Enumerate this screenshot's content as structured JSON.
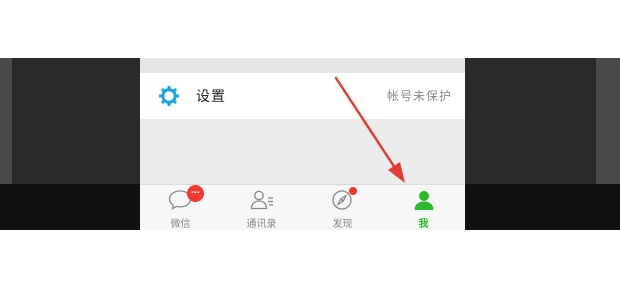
{
  "settings": {
    "label": "设置",
    "status": "帐号未保护",
    "icon": "gear-icon",
    "icon_color": "#1aa5e8"
  },
  "tabbar": {
    "tabs": [
      {
        "label": "微信",
        "icon": "chat-bubble-icon",
        "badge": "…",
        "active": false
      },
      {
        "label": "通讯录",
        "icon": "contacts-icon",
        "active": false
      },
      {
        "label": "发现",
        "icon": "compass-icon",
        "badge_dot": true,
        "active": false
      },
      {
        "label": "我",
        "icon": "person-icon",
        "active": true
      }
    ],
    "active_color": "#2db72a",
    "badge_color": "#f43530"
  },
  "annotation": {
    "type": "arrow",
    "color": "#e63b35"
  }
}
